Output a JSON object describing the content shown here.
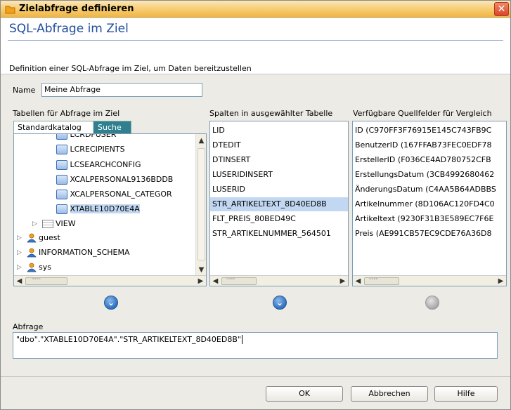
{
  "window": {
    "title": "Zielabfrage definieren",
    "close_glyph": "✕"
  },
  "header": {
    "title": "SQL-Abfrage im Ziel",
    "description": "Definition einer SQL-Abfrage im Ziel, um Daten bereitzustellen"
  },
  "name": {
    "label": "Name",
    "value": "Meine Abfrage"
  },
  "tables": {
    "label": "Tabellen für Abfrage im Ziel",
    "tabs": [
      "Standardkatalog",
      "Suche"
    ],
    "tree": [
      {
        "label": "LCRDFUSER",
        "type": "table"
      },
      {
        "label": "LCRECIPIENTS",
        "type": "table"
      },
      {
        "label": "LCSEARCHCONFIG",
        "type": "table"
      },
      {
        "label": "XCALPERSONAL9136BDDB",
        "type": "table"
      },
      {
        "label": "XCALPERSONAL_CATEGOR",
        "type": "table"
      },
      {
        "label": "XTABLE10D70E4A",
        "type": "table"
      },
      {
        "label": "VIEW",
        "type": "view"
      },
      {
        "label": "guest",
        "type": "schema"
      },
      {
        "label": "INFORMATION_SCHEMA",
        "type": "schema"
      },
      {
        "label": "sys",
        "type": "schema"
      }
    ]
  },
  "columns": {
    "label": "Spalten in ausgewählter Tabelle",
    "items": [
      "LID",
      "DTEDIT",
      "DTINSERT",
      "LUSERIDINSERT",
      "LUSERID",
      "STR_ARTIKELTEXT_8D40ED8B",
      "FLT_PREIS_80BED49C",
      "STR_ARTIKELNUMMER_564501"
    ]
  },
  "source_fields": {
    "label": "Verfügbare Quellfelder für Vergleich",
    "items": [
      "ID (C970FF3F76915E145C743FB9C",
      "BenutzerID (167FFAB73FEC0EDF78",
      "ErstellerID (F036CE4AD780752CFB",
      "ErstellungsDatum (3CB4992680462",
      "ÄnderungsDatum (C4AA5B64ADBBS",
      "Artikelnummer (8D106AC120FD4C0",
      "Artikeltext (9230F31B3E589EC7F6E",
      "Preis (AE991CB57EC9CDE76A36D8"
    ]
  },
  "query": {
    "label": "Abfrage",
    "value": "\"dbo\".\"XTABLE10D70E4A\".\"STR_ARTIKELTEXT_8D40ED8B\""
  },
  "buttons": {
    "ok": "OK",
    "cancel": "Abbrechen",
    "help": "Hilfe"
  },
  "scroll_grip": "\"\"\"\"",
  "colors": {
    "title_gradient": "#f6c96a",
    "header_title": "#1f4d9e",
    "selection": "#c2d8f2"
  }
}
